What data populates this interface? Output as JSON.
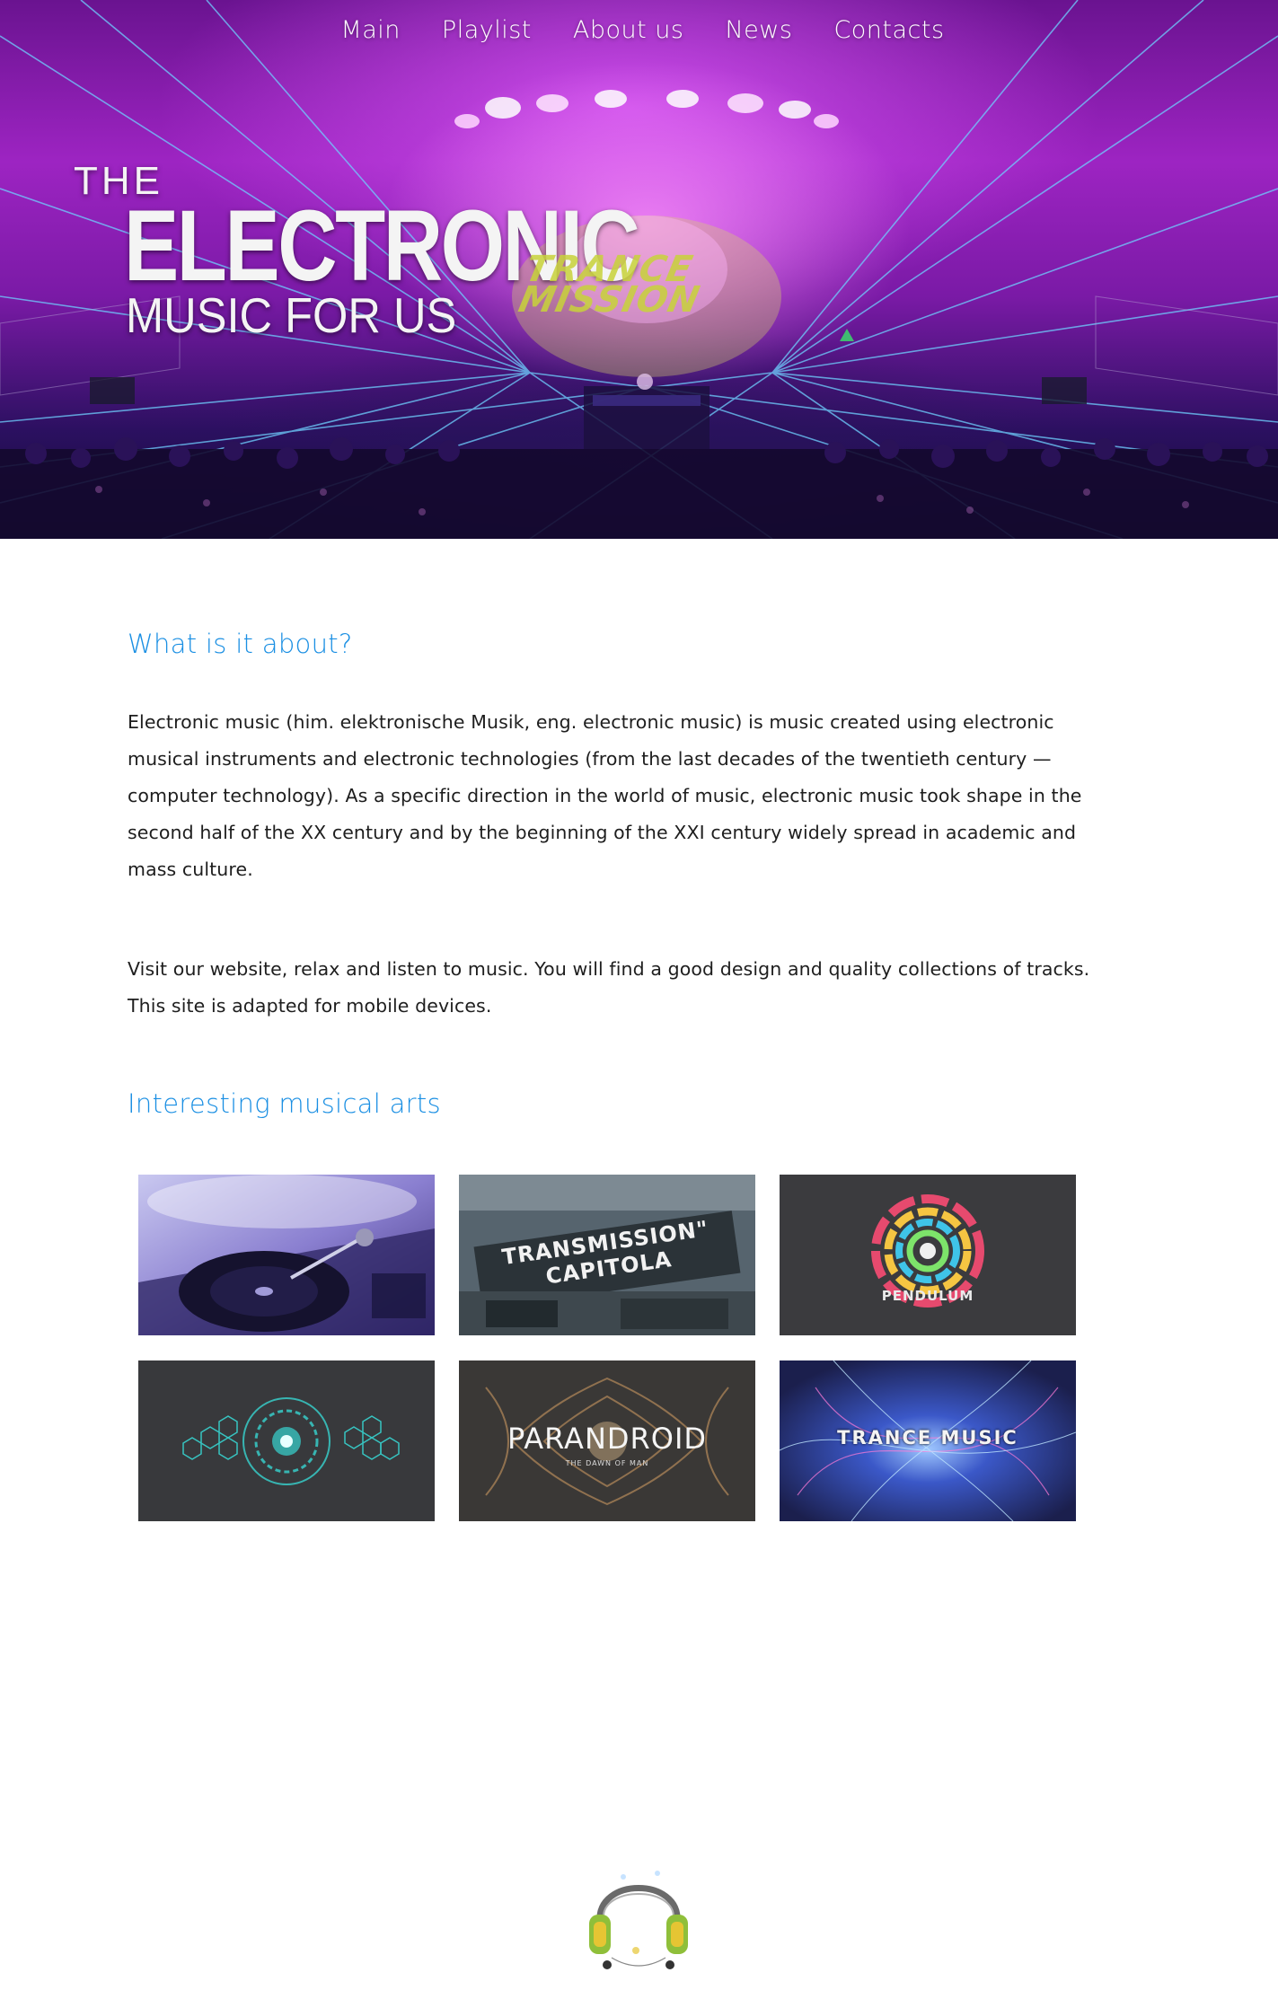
{
  "nav": {
    "items": [
      {
        "label": "Main"
      },
      {
        "label": "Playlist"
      },
      {
        "label": "About us"
      },
      {
        "label": "News"
      },
      {
        "label": "Contacts"
      }
    ]
  },
  "hero": {
    "title_line1": "THE",
    "title_line2": "ELECTRONIC",
    "title_line3": "MUSIC FOR US",
    "stage_logo": "TRANCE MISSION"
  },
  "about": {
    "heading": "What is it about?",
    "paragraph1": "Electronic music (him. elektronische Musik, eng. electronic music) is music created using electronic musical instruments and electronic technologies (from the last decades of the twentieth century — computer technology). As a specific direction in the world of music, electronic music took shape in the second half of the XX century and by the beginning of the XXI century widely spread in academic and mass culture.",
    "paragraph2": "Visit our website, relax and listen to music. You will find a good design and quality collections of tracks. This site is adapted for mobile devices."
  },
  "arts": {
    "heading": "Interesting musical arts",
    "items": [
      {
        "caption": ""
      },
      {
        "caption": "TRANSMISSION\" CAPITOLA"
      },
      {
        "caption": "PENDULUM"
      },
      {
        "caption": ""
      },
      {
        "caption": "PARANDROID",
        "subcaption": "THE DAWN OF MAN"
      },
      {
        "caption": "TRANCE MUSIC"
      }
    ]
  },
  "colors": {
    "accent": "#1a8fe3",
    "text": "#1e1e1e",
    "hero_purple": "#9d24c2"
  },
  "footer": {
    "logo_icon": "headphones-icon"
  }
}
